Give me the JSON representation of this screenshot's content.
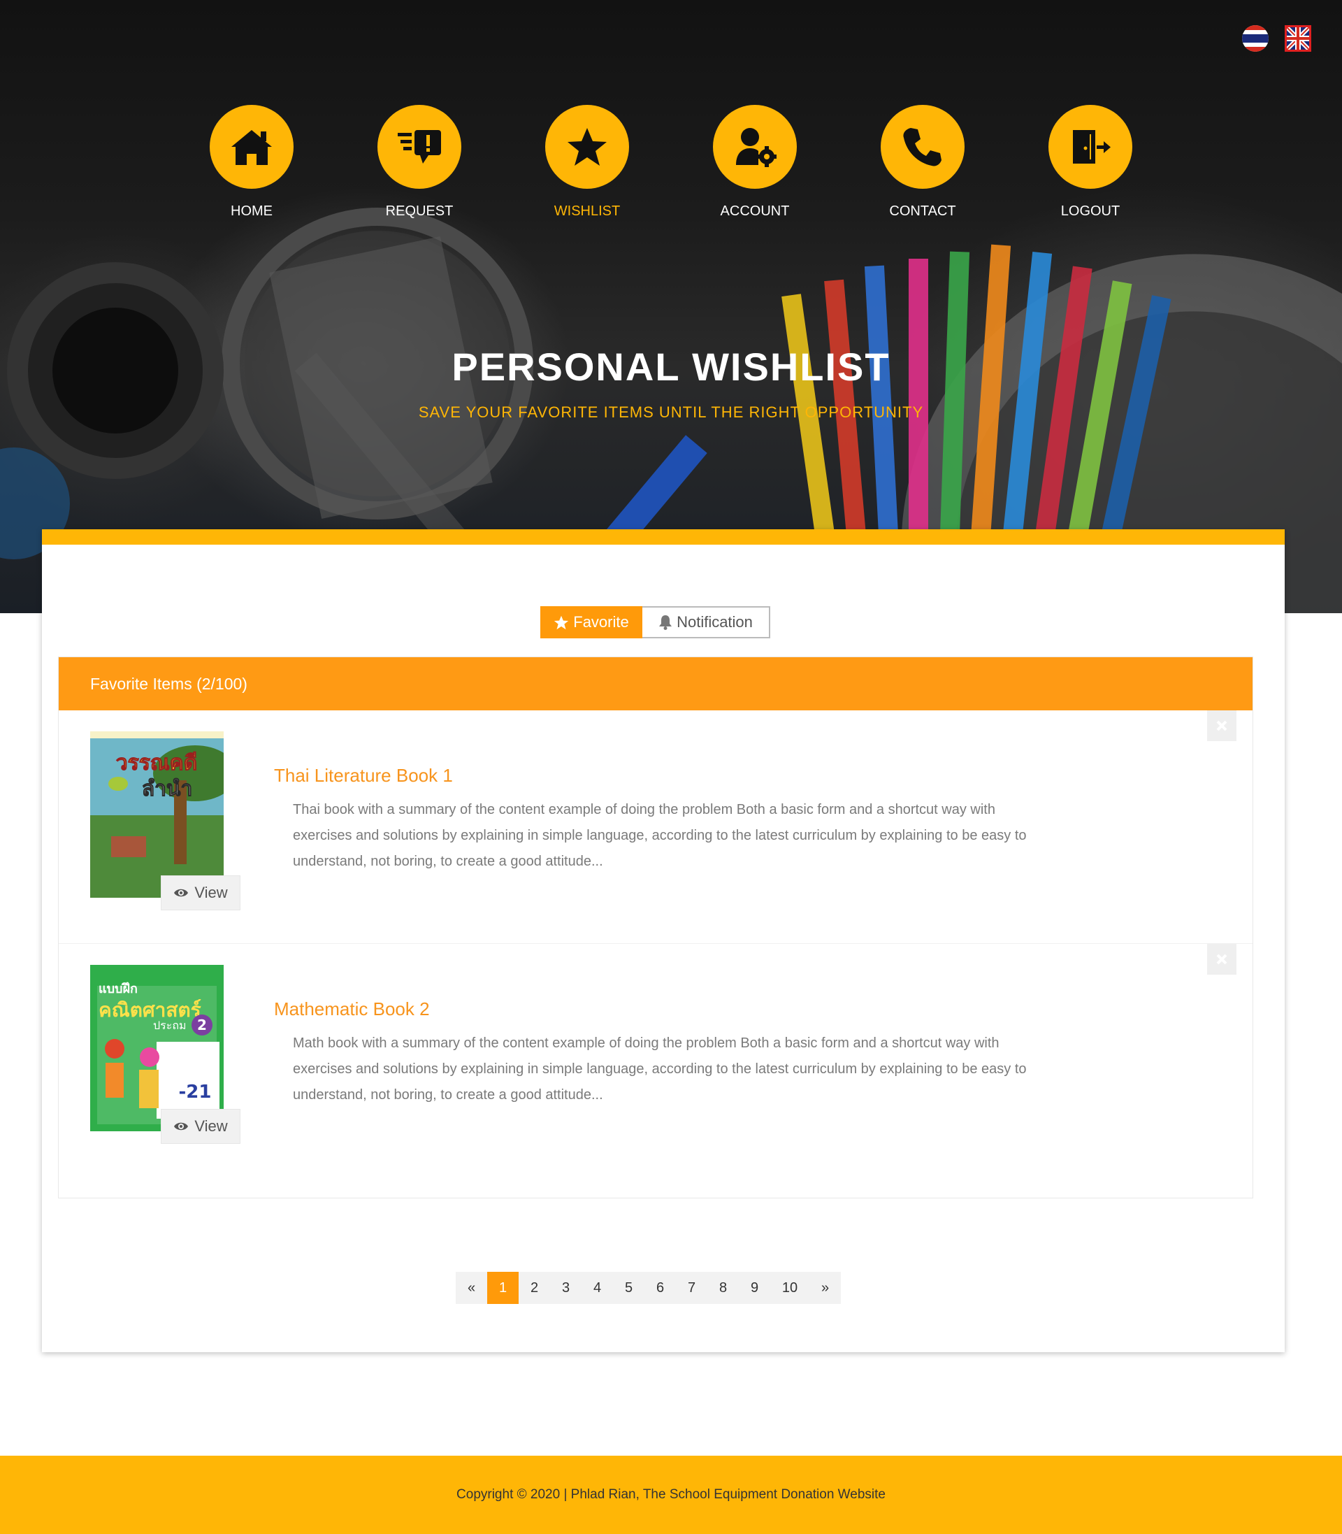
{
  "languages": [
    {
      "name": "thai-flag-icon"
    },
    {
      "name": "uk-flag-icon"
    }
  ],
  "nav": [
    {
      "label": "HOME",
      "icon": "home-icon"
    },
    {
      "label": "REQUEST",
      "icon": "request-icon"
    },
    {
      "label": "WISHLIST",
      "icon": "star-icon",
      "active": true
    },
    {
      "label": "ACCOUNT",
      "icon": "user-gear-icon"
    },
    {
      "label": "CONTACT",
      "icon": "phone-icon"
    },
    {
      "label": "LOGOUT",
      "icon": "logout-door-icon"
    }
  ],
  "hero": {
    "title": "PERSONAL WISHLIST",
    "subtitle": "SAVE YOUR FAVORITE ITEMS UNTIL THE RIGHT OPPORTUNITY"
  },
  "tabs": {
    "favorite": "Favorite",
    "notification": "Notification"
  },
  "panel": {
    "header": "Favorite Items (2/100)"
  },
  "items": [
    {
      "title": "Thai Literature Book 1",
      "description": "Thai book with a summary of the content example of doing the problem Both a basic form and a shortcut way with exercises and solutions by explaining in simple language, according to the latest curriculum by explaining to be easy to understand, not boring, to create a good attitude...",
      "view_label": "View",
      "cover_text": "วรรณคดี ลำนำ"
    },
    {
      "title": "Mathematic Book 2",
      "description": "Math book with a summary of the content example of doing the problem Both a basic form and a shortcut way with exercises and solutions by explaining in simple language, according to the latest curriculum by explaining to be easy to understand, not boring, to create a good attitude...",
      "view_label": "View",
      "cover_text": "แบบฝึก คณิตศาสตร์ ประถม 2"
    }
  ],
  "pagination": {
    "prev": "«",
    "pages": [
      "1",
      "2",
      "3",
      "4",
      "5",
      "6",
      "7",
      "8",
      "9",
      "10"
    ],
    "current": 1,
    "next": "»"
  },
  "footer": {
    "text": "Copyright © 2020 | Phlad Rian, The School Equipment Donation Website"
  },
  "colors": {
    "accent": "#ffb606",
    "orange": "#ff9a0a",
    "link": "#f7941d"
  }
}
